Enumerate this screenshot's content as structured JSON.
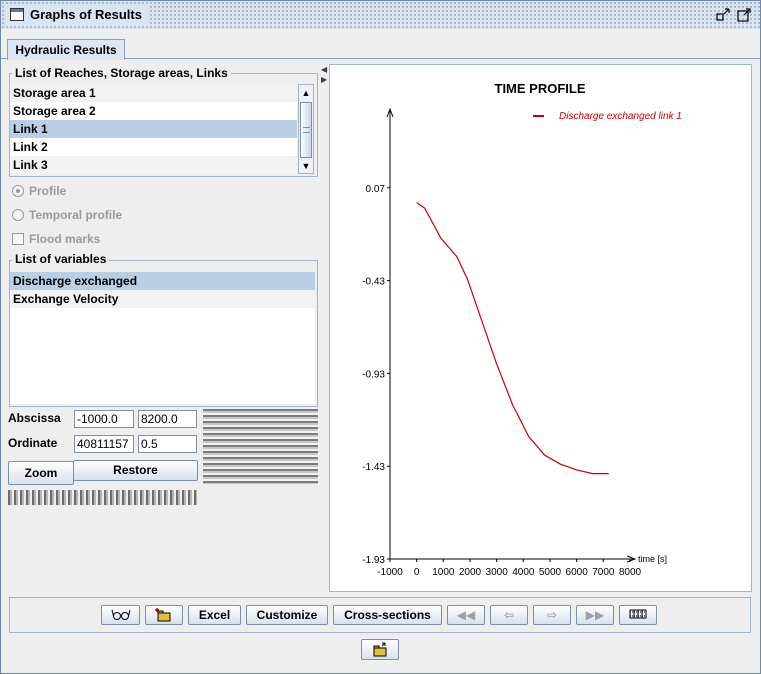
{
  "window": {
    "title": "Graphs of Results"
  },
  "tabs": [
    {
      "label": "Hydraulic Results"
    }
  ],
  "left": {
    "reaches_title": "List of Reaches, Storage areas, Links",
    "reaches": [
      "Storage area 1",
      "Storage area 2",
      "Link 1",
      "Link 2",
      "Link 3"
    ],
    "selected_reach": "Link 1",
    "options": [
      {
        "label": "Profile",
        "type": "radio",
        "checked": true
      },
      {
        "label": "Temporal profile",
        "type": "radio",
        "checked": false
      },
      {
        "label": "Flood marks",
        "type": "checkbox",
        "checked": false
      }
    ],
    "variables_title": "List of variables",
    "variables": [
      "Discharge exchanged",
      "Exchange Velocity"
    ],
    "selected_variable": "Discharge exchanged",
    "abscissa_label": "Abscissa",
    "abscissa_min": "-1000.0",
    "abscissa_max": "8200.0",
    "ordinate_label": "Ordinate",
    "ordinate_min": "40811157",
    "ordinate_max": "0.5",
    "zoom_label": "Zoom",
    "restore_label": "Restore"
  },
  "toolbar": {
    "excel_label": "Excel",
    "customize_label": "Customize",
    "cross_sections_label": "Cross-sections"
  },
  "icons": {
    "glasses": "glasses-icon",
    "folder_add": "folder-add-icon",
    "first": "first-page-icon",
    "prev": "previous-icon",
    "next": "next-icon",
    "last": "last-page-icon",
    "film": "film-strip-icon",
    "folder_open": "folder-open-icon"
  },
  "chart_data": {
    "type": "line",
    "title": "TIME PROFILE",
    "xlabel": "time [s]",
    "ylabel": "",
    "xlim": [
      -1000,
      8000
    ],
    "ylim": [
      -1.93,
      0.57
    ],
    "xticks": [
      "-1000",
      "0",
      "1000",
      "2000",
      "3000",
      "4000",
      "5000",
      "6000",
      "7000",
      "8000"
    ],
    "yticks": [
      "0.07",
      "-0.43",
      "-0.93",
      "-1.43",
      "-1.93"
    ],
    "ytick_values": [
      0.07,
      -0.43,
      -0.93,
      -1.43,
      -1.93
    ],
    "legend_position": "top-right",
    "series": [
      {
        "name": "Discharge exchanged link 1",
        "color": "#cc0000",
        "x": [
          0,
          300,
          900,
          1500,
          1900,
          2400,
          3000,
          3600,
          4200,
          4800,
          5400,
          6000,
          6600,
          7200
        ],
        "y": [
          -0.01,
          -0.04,
          -0.2,
          -0.3,
          -0.42,
          -0.63,
          -0.88,
          -1.1,
          -1.27,
          -1.37,
          -1.42,
          -1.45,
          -1.47,
          -1.47
        ]
      }
    ]
  }
}
